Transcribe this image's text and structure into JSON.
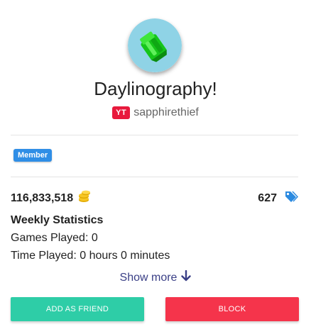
{
  "profile": {
    "display_name": "Daylinography!",
    "platform_badge": "YT",
    "handle": "sapphirethief",
    "role": "Member",
    "avatar_icon": "green-gem-icon",
    "avatar_bg": "#8fd3e6"
  },
  "stats": {
    "coins": "116,833,518",
    "coins_icon": "coin-stack-icon",
    "tags": "627",
    "tags_icon": "tags-icon",
    "heading": "Weekly Statistics",
    "games_played": "Games Played: 0",
    "time_played": "Time Played: 0 hours 0 minutes"
  },
  "show_more": {
    "label": "Show more",
    "icon": "arrow-down-icon"
  },
  "actions": {
    "add_friend_label": "ADD AS FRIEND",
    "block_label": "BLOCK"
  },
  "colors": {
    "add_friend": "#2ecda7",
    "block": "#f5344b",
    "role_badge": "#2f8ee6",
    "platform_badge": "#e8193c",
    "link": "#3a3f86"
  }
}
